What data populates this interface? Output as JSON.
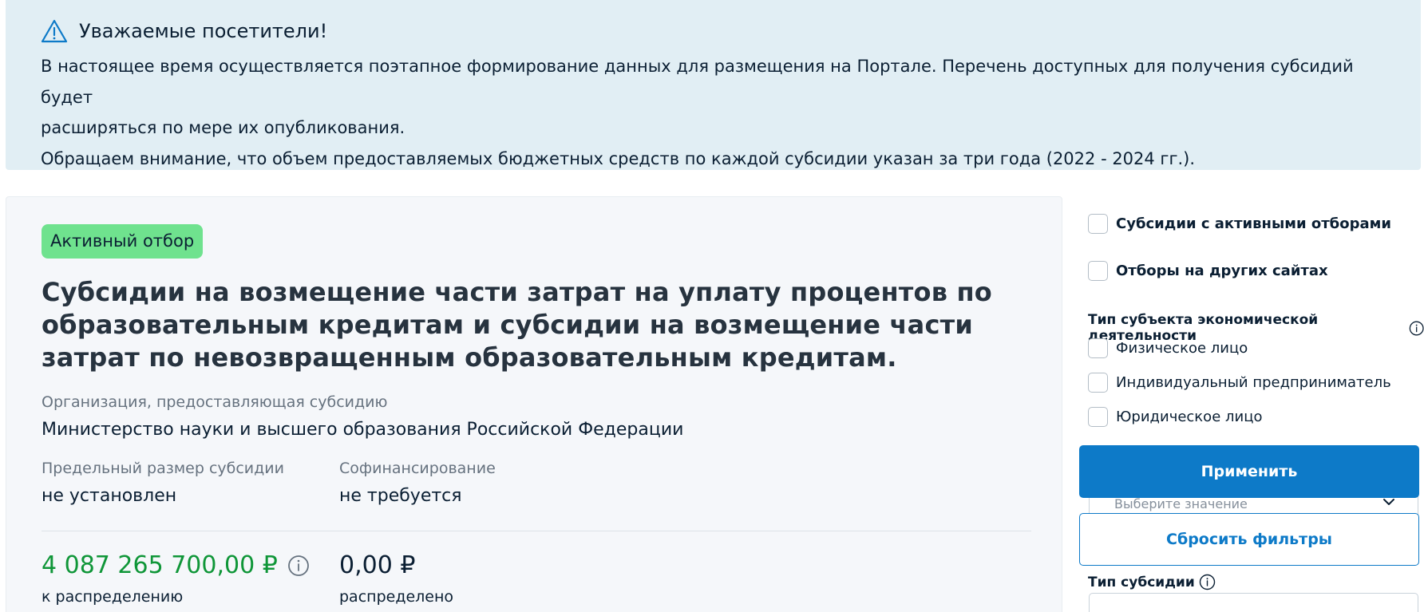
{
  "notice": {
    "icon": "warning-triangle-icon",
    "title": "Уважаемые посетители!",
    "line1": "В настоящее время осуществляется поэтапное формирование данных для размещения на Портале. Перечень доступных для получения субсидий будет",
    "line2": "расширяться по мере их опубликования.",
    "line3": "Обращаем внимание, что объем предоставляемых бюджетных средств по каждой субсидии указан за три года (2022 - 2024 гг.)."
  },
  "card": {
    "badge": "Активный отбор",
    "title": "Субсидии на возмещение части затрат на уплату процентов по образовательным кредитам и субсидии на возмещение части затрат по невозвращенным образовательным кредитам.",
    "org_label": "Организация, предоставляющая субсидию",
    "org_value": "Министерство науки и высшего образования Российской Федерации",
    "limit_label": "Предельный размер субсидии",
    "limit_value": "не установлен",
    "cofin_label": "Софинансирование",
    "cofin_value": "не требуется",
    "to_distribute_amount": "4 087 265 700,00 ₽",
    "to_distribute_label": "к распределению",
    "distributed_amount": "0,00 ₽",
    "distributed_label": "распределено"
  },
  "filters": {
    "active_selections": "Субсидии с активными отборами",
    "other_sites": "Отборы на других сайтах",
    "subject_type_label": "Тип субъекта экономической деятельности",
    "subject_types": [
      "Физическое лицо",
      "Индивидуальный предприниматель",
      "Юридическое лицо"
    ],
    "select_placeholder": "Выберите значение",
    "apply_button": "Применить",
    "reset_button": "Сбросить фильтры",
    "subsidy_type_label": "Тип субсидии"
  },
  "colors": {
    "notice_bg": "#e1eef4",
    "badge_bg": "#6fe28e",
    "primary": "#0d7ac8",
    "amount_green": "#0f9638"
  }
}
